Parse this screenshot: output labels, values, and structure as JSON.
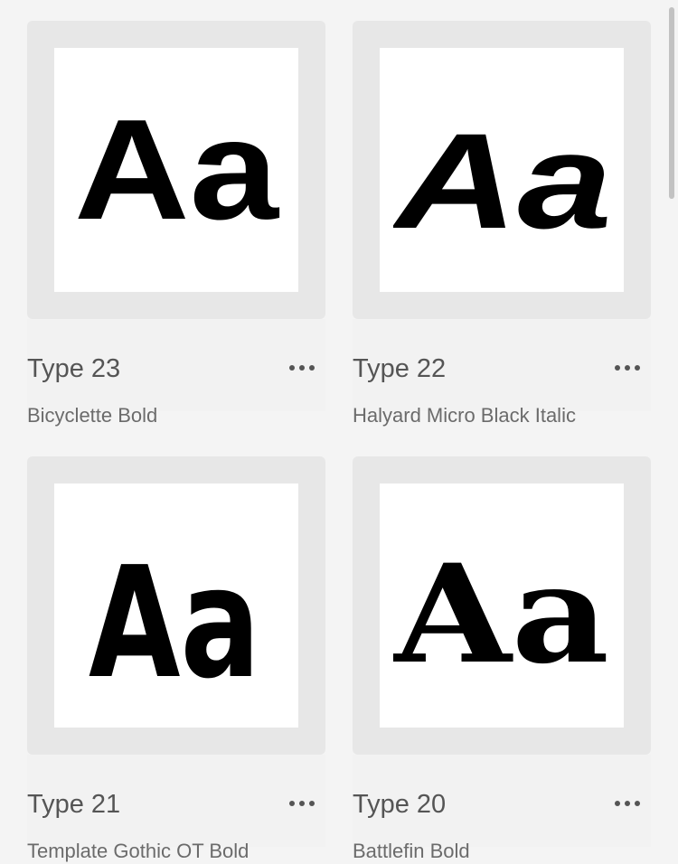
{
  "fonts": [
    {
      "title": "Type 23",
      "subtitle": "Bicyclette Bold",
      "sample": "Aa"
    },
    {
      "title": "Type 22",
      "subtitle": "Halyard Micro Black Italic",
      "sample": "Aa"
    },
    {
      "title": "Type 21",
      "subtitle": "Template Gothic OT Bold",
      "sample": "Aa"
    },
    {
      "title": "Type 20",
      "subtitle": "Battlefin Bold",
      "sample": "Aa"
    }
  ],
  "icons": {
    "more": "more-horizontal-icon"
  },
  "colors": {
    "page_background": "#f4f4f4",
    "thumb_frame": "#e7e7e7",
    "thumb_background": "#ffffff",
    "title_text": "#555555",
    "subtitle_text": "#6b6b6b"
  }
}
